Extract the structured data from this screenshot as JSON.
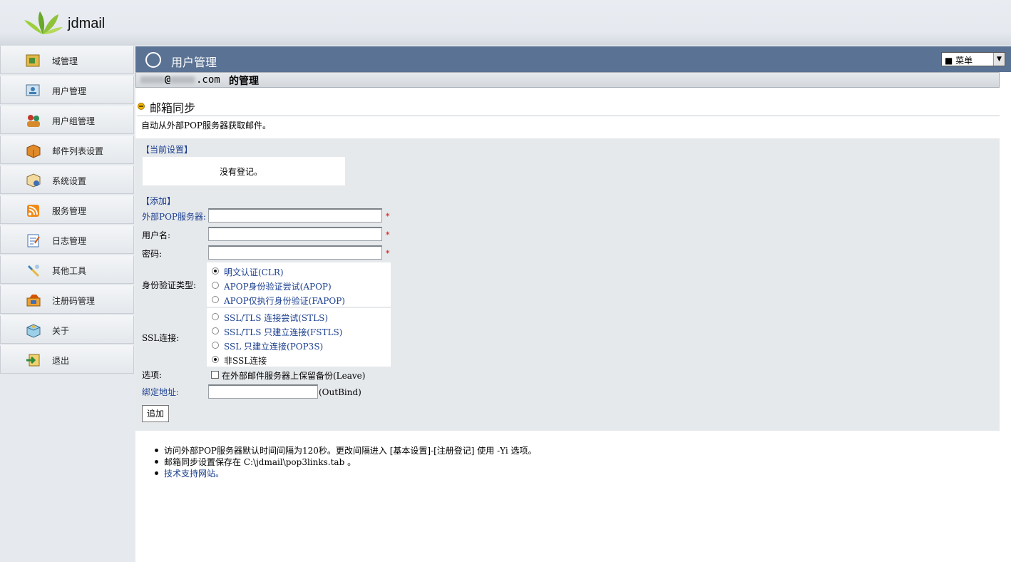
{
  "header": {
    "app_title": "jdmail"
  },
  "sidebar": {
    "items": [
      {
        "label": "域管理",
        "icon": "domain-icon"
      },
      {
        "label": "用户管理",
        "icon": "user-icon"
      },
      {
        "label": "用户组管理",
        "icon": "group-icon"
      },
      {
        "label": "邮件列表设置",
        "icon": "mail-list-icon"
      },
      {
        "label": "系统设置",
        "icon": "system-icon"
      },
      {
        "label": "服务管理",
        "icon": "service-icon"
      },
      {
        "label": "日志管理",
        "icon": "log-icon"
      },
      {
        "label": "其他工具",
        "icon": "tools-icon"
      },
      {
        "label": "注册码管理",
        "icon": "license-icon"
      },
      {
        "label": "关于",
        "icon": "about-icon"
      },
      {
        "label": "退出",
        "icon": "logout-icon"
      }
    ]
  },
  "titlebar": {
    "heading": "用户管理",
    "menu_value": "■ 菜单"
  },
  "account": {
    "at": "@",
    "domain": ".com",
    "suffix": "的管理"
  },
  "section": {
    "title": "邮箱同步",
    "description": "自动从外部POP服务器获取邮件。"
  },
  "current": {
    "label": "【当前设置】",
    "empty_text": "没有登记。"
  },
  "form": {
    "add_label": "【添加】",
    "server_label": "外部POP服务器:",
    "username_label": "用户名:",
    "password_label": "密码:",
    "required_mark": "*",
    "auth_label": "身份验证类型:",
    "auth_options": [
      "明文认证(CLR)",
      "APOP身份验证尝试(APOP)",
      "APOP仅执行身份验证(FAPOP)"
    ],
    "auth_selected": 0,
    "ssl_label": "SSL连接:",
    "ssl_options": [
      "SSL/TLS 连接尝试(STLS)",
      "SSL/TLS 只建立连接(FSTLS)",
      "SSL 只建立连接(POP3S)",
      "非SSL连接"
    ],
    "ssl_selected": 3,
    "option_label": "选项:",
    "option_leave": "在外部邮件服务器上保留备份(Leave)",
    "bind_label": "绑定地址:",
    "bind_note": "(OutBind)",
    "add_button": "追加"
  },
  "notes": {
    "note1": "访问外部POP服务器默认时间间隔为120秒。更改间隔进入 [基本设置]-[注册登记] 使用 -Yi 选项。",
    "note2": "邮箱同步设置保存在 C:\\jdmail\\pop3links.tab 。",
    "note3": "技术支持网站。"
  },
  "colors": {
    "titlebar": "#5a7294",
    "panel": "#e6e9ec",
    "link": "#1b3f8f"
  }
}
